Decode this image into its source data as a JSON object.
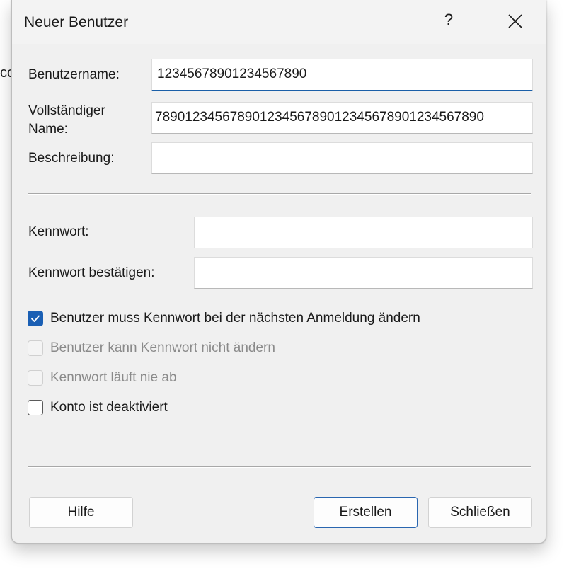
{
  "background": {
    "fragment_text": "co"
  },
  "dialog": {
    "title": "Neuer Benutzer",
    "help_glyph": "?",
    "accent_color": "#1a5fb4"
  },
  "fields": {
    "username": {
      "label": "Benutzername:",
      "value": "12345678901234567890"
    },
    "fullname": {
      "label_line1": "Vollständiger",
      "label_line2": "Name:",
      "value": "78901234567890123456789012345678901234567890"
    },
    "description": {
      "label": "Beschreibung:",
      "value": ""
    },
    "password": {
      "label": "Kennwort:",
      "value": ""
    },
    "confirm_password": {
      "label": "Kennwort bestätigen:",
      "value": ""
    }
  },
  "checkboxes": [
    {
      "label": "Benutzer muss Kennwort bei der nächsten Anmeldung ändern",
      "checked": true,
      "enabled": true
    },
    {
      "label": "Benutzer kann Kennwort nicht ändern",
      "checked": false,
      "enabled": false
    },
    {
      "label": "Kennwort läuft nie ab",
      "checked": false,
      "enabled": false
    },
    {
      "label": "Konto ist deaktiviert",
      "checked": false,
      "enabled": true
    }
  ],
  "buttons": {
    "help": "Hilfe",
    "create": "Erstellen",
    "close": "Schließen"
  }
}
